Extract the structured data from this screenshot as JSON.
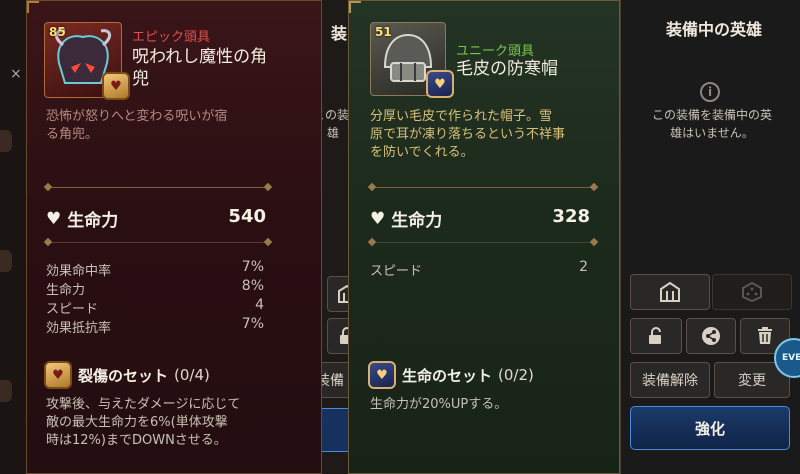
{
  "left_item": {
    "level": "85",
    "rarity": "エピック頭具",
    "rarity_color": "#e05050",
    "name_line1": "呪われし魔性の角",
    "name_line2": "兜",
    "description_line1": "恐怖が怒りへと変わる呪いが宿",
    "description_line2": "る角兜。",
    "main_stat": {
      "label": "生命力",
      "value": "540"
    },
    "sub_stats": [
      {
        "label": "効果命中率",
        "value": "7%"
      },
      {
        "label": "生命力",
        "value": "8%"
      },
      {
        "label": "スピード",
        "value": "4"
      },
      {
        "label": "効果抵抗率",
        "value": "7%"
      }
    ],
    "set": {
      "name": "裂傷のセット",
      "count": "(0/4)"
    },
    "set_desc_line1": "攻撃後、与えたダメージに応じて",
    "set_desc_line2": "敵の最大生命力を6%(単体攻撃",
    "set_desc_line3": "時は12%)までDOWNさせる。",
    "side_panel": {
      "title_partial": "装",
      "text_line1": "この装",
      "text_line2": "雄",
      "button_partial": "装備"
    }
  },
  "right_item": {
    "level": "51",
    "rarity": "ユニーク頭具",
    "rarity_color": "#7ac84a",
    "name": "毛皮の防寒帽",
    "description_line1": "分厚い毛皮で作られた帽子。雪",
    "description_line2": "原で耳が凍り落ちるという不祥事",
    "description_line3": "を防いでくれる。",
    "main_stat": {
      "label": "生命力",
      "value": "328"
    },
    "sub_stats": [
      {
        "label": "スピード",
        "value": "2"
      }
    ],
    "set": {
      "name": "生命のセット",
      "count": "(0/2)"
    },
    "set_desc": "生命力が20%UPする。"
  },
  "equipped_panel": {
    "title": "装備中の英雄",
    "info_line1": "この装備を装備中の英",
    "info_line2": "雄はいません。",
    "unequip_label": "装備解除",
    "change_label": "変更",
    "enhance_label": "強化",
    "event_badge": "EVEN"
  }
}
